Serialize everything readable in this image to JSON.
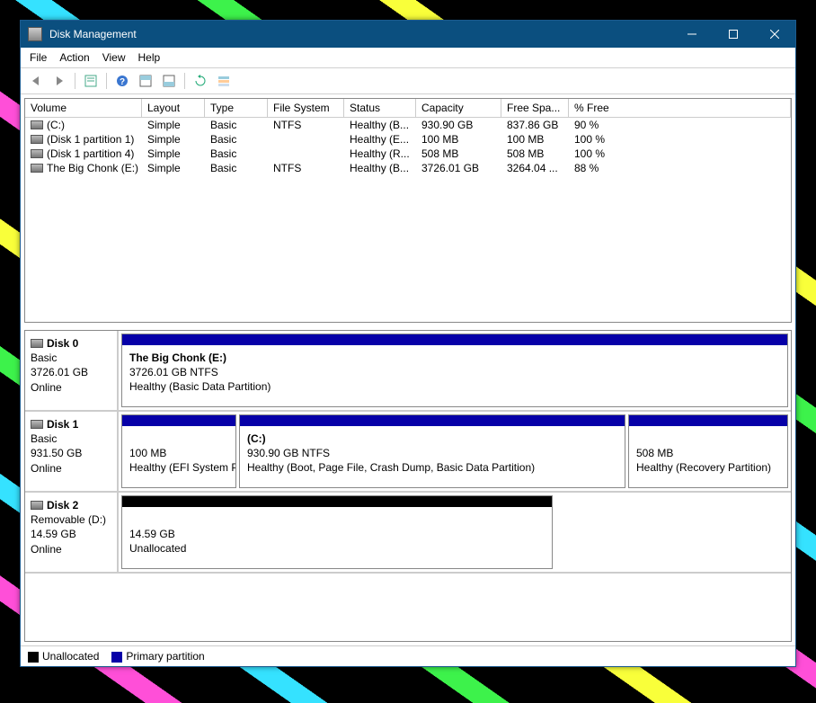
{
  "window": {
    "title": "Disk Management"
  },
  "menu": {
    "file": "File",
    "action": "Action",
    "view": "View",
    "help": "Help"
  },
  "columns": {
    "volume": "Volume",
    "layout": "Layout",
    "type": "Type",
    "fs": "File System",
    "status": "Status",
    "capacity": "Capacity",
    "free": "Free Spa...",
    "pct": "% Free"
  },
  "volumes": [
    {
      "name": "(C:)",
      "layout": "Simple",
      "type": "Basic",
      "fs": "NTFS",
      "status": "Healthy (B...",
      "capacity": "930.90 GB",
      "free": "837.86 GB",
      "pct": "90 %"
    },
    {
      "name": "(Disk 1 partition 1)",
      "layout": "Simple",
      "type": "Basic",
      "fs": "",
      "status": "Healthy (E...",
      "capacity": "100 MB",
      "free": "100 MB",
      "pct": "100 %"
    },
    {
      "name": "(Disk 1 partition 4)",
      "layout": "Simple",
      "type": "Basic",
      "fs": "",
      "status": "Healthy (R...",
      "capacity": "508 MB",
      "free": "508 MB",
      "pct": "100 %"
    },
    {
      "name": "The Big Chonk (E:)",
      "layout": "Simple",
      "type": "Basic",
      "fs": "NTFS",
      "status": "Healthy (B...",
      "capacity": "3726.01 GB",
      "free": "3264.04 ...",
      "pct": "88 %"
    }
  ],
  "disks": {
    "d0": {
      "name": "Disk 0",
      "type": "Basic",
      "size": "3726.01 GB",
      "status": "Online"
    },
    "d1": {
      "name": "Disk 1",
      "type": "Basic",
      "size": "931.50 GB",
      "status": "Online"
    },
    "d2": {
      "name": "Disk 2",
      "type": "Removable (D:)",
      "size": "14.59 GB",
      "status": "Online"
    }
  },
  "d0p0": {
    "title": "The Big Chonk  (E:)",
    "line2": "3726.01 GB NTFS",
    "line3": "Healthy (Basic Data Partition)"
  },
  "d1p0": {
    "title": "",
    "line2": "100 MB",
    "line3": "Healthy (EFI System P"
  },
  "d1p1": {
    "title": "(C:)",
    "line2": "930.90 GB NTFS",
    "line3": "Healthy (Boot, Page File, Crash Dump, Basic Data Partition)"
  },
  "d1p2": {
    "title": "",
    "line2": "508 MB",
    "line3": "Healthy (Recovery Partition)"
  },
  "d2p0": {
    "title": "",
    "line2": "14.59 GB",
    "line3": "Unallocated"
  },
  "legend": {
    "unallocated": "Unallocated",
    "primary": "Primary partition"
  }
}
